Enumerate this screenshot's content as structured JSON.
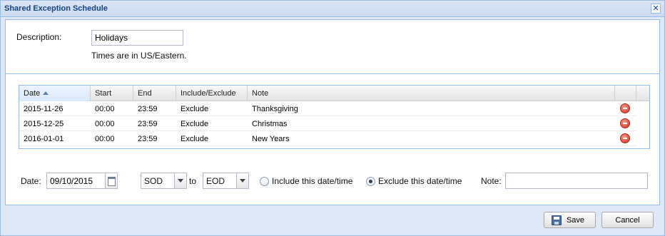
{
  "window": {
    "title": "Shared Exception Schedule",
    "close_glyph": "✕"
  },
  "top": {
    "description_label": "Description:",
    "description_value": "Holidays",
    "timezone_note": "Times are in US/Eastern."
  },
  "grid": {
    "columns": [
      "Date",
      "Start",
      "End",
      "Include/Exclude",
      "Note"
    ],
    "sorted_column": "Date",
    "rows": [
      {
        "date": "2015-11-26",
        "start": "00:00",
        "end": "23:59",
        "mode": "Exclude",
        "note": "Thanksgiving"
      },
      {
        "date": "2015-12-25",
        "start": "00:00",
        "end": "23:59",
        "mode": "Exclude",
        "note": "Christmas"
      },
      {
        "date": "2016-01-01",
        "start": "00:00",
        "end": "23:59",
        "mode": "Exclude",
        "note": "New Years"
      }
    ],
    "row_action_icon": "remove-icon"
  },
  "form": {
    "date_label": "Date:",
    "date_value": "09/10/2015",
    "start_value": "SOD",
    "to_label": "to",
    "end_value": "EOD",
    "include_label": "Include this date/time",
    "exclude_label": "Exclude this date/time",
    "selected": "exclude",
    "note_label": "Note:",
    "note_value": ""
  },
  "buttons": {
    "save": "Save",
    "cancel": "Cancel"
  },
  "colors": {
    "accent": "#15428b",
    "frame": "#99bbe8",
    "background": "#dfe8f6",
    "delete": "#d42b1e"
  }
}
